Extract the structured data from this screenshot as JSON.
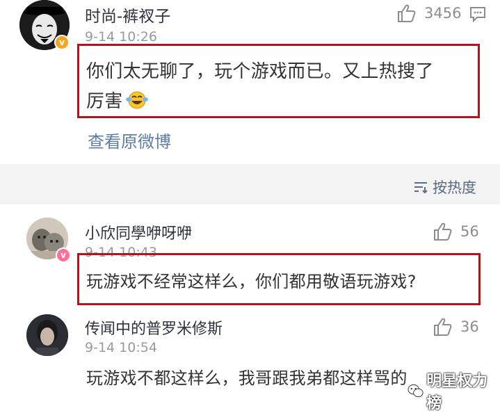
{
  "comments": [
    {
      "username": "时尚-裤衩子",
      "time": "9-14 10:26",
      "likes": "3456",
      "content_line1": "你们太无聊了，玩个游戏而已。又上热搜了",
      "content_line2": "厉害",
      "view_original": "查看原微博",
      "badge_color": "#f5a623"
    },
    {
      "username": "小欣同學咿呀咿",
      "time": "9-14 10:43",
      "likes": "56",
      "content": "玩游戏不经常这样么，你们都用敬语玩游戏?",
      "badge_color": "#ff6f9a"
    },
    {
      "username": "传闻中的普罗米修斯",
      "time": "9-14 10:54",
      "likes": "36",
      "content": "玩游戏不都这样么，我哥跟我弟都这样骂的"
    }
  ],
  "sort_label": "按热度",
  "watermark": "明星权力榜",
  "icons": [
    "thumbs-up-icon",
    "comment-icon",
    "sort-icon",
    "laugh-cry-emoji-icon",
    "wechat-icon"
  ],
  "colors": {
    "highlight_border": "#b3141c",
    "link": "#5d7ca6"
  }
}
